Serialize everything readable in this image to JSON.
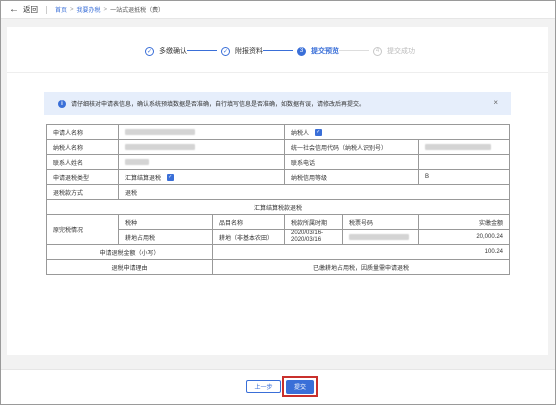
{
  "topbar": {
    "back_label": "返回",
    "breadcrumb": [
      "首页",
      "我要办税",
      "一站式退抵税（费）"
    ]
  },
  "steps": [
    {
      "number": "1",
      "label": "多缴确认",
      "state": "done"
    },
    {
      "number": "2",
      "label": "附报资料",
      "state": "done"
    },
    {
      "number": "3",
      "label": "提交预览",
      "state": "active"
    },
    {
      "number": "4",
      "label": "提交成功",
      "state": "todo"
    }
  ],
  "notice": {
    "text": "请仔细核对申请表信息，确认系统预填数据是否准确，自行填写信息是否准确，如数据有误，请修改后再提交。",
    "close": "×"
  },
  "form": {
    "applicant_name_label": "申请人名称",
    "taxpayer_label": "纳税人",
    "taxpayer_name_label": "纳税人名称",
    "credit_code_label": "统一社会信用代码（纳税人识别号）",
    "contact_name_label": "联系人姓名",
    "contact_phone_label": "联系电话",
    "refund_type_label": "申请退税类型",
    "refund_type_value": "汇算结算退税",
    "credit_level_label": "纳税信用等级",
    "credit_level_value": "B",
    "refund_method_label": "退税款方式",
    "refund_method_value": "退税",
    "section_title": "汇算结算税款退税",
    "original_tax_label": "原完税情况",
    "col_tax_type": "税种",
    "col_item_name": "品目名称",
    "col_period": "税款所属时期",
    "col_ticket_no": "税票号码",
    "col_paid_amount": "实缴金额",
    "row_tax_type": "耕地占用税",
    "row_item_name": "耕地（非基本农田）",
    "row_period_line1": "2020/03/16-",
    "row_period_line2": "2020/03/16",
    "row_paid_amount": "20,000.24",
    "refund_amount_label": "申请退税金额（小写）",
    "refund_amount_value": "100.24",
    "refund_reason_label": "退税申请理由",
    "refund_reason_value": "已缴耕地占用税，因质量需申请退税"
  },
  "footer": {
    "prev_label": "上一步",
    "submit_label": "提交"
  },
  "colors": {
    "accent": "#3a6fd8",
    "highlight_border": "#c9302c",
    "notice_bg": "#e6eefb"
  }
}
